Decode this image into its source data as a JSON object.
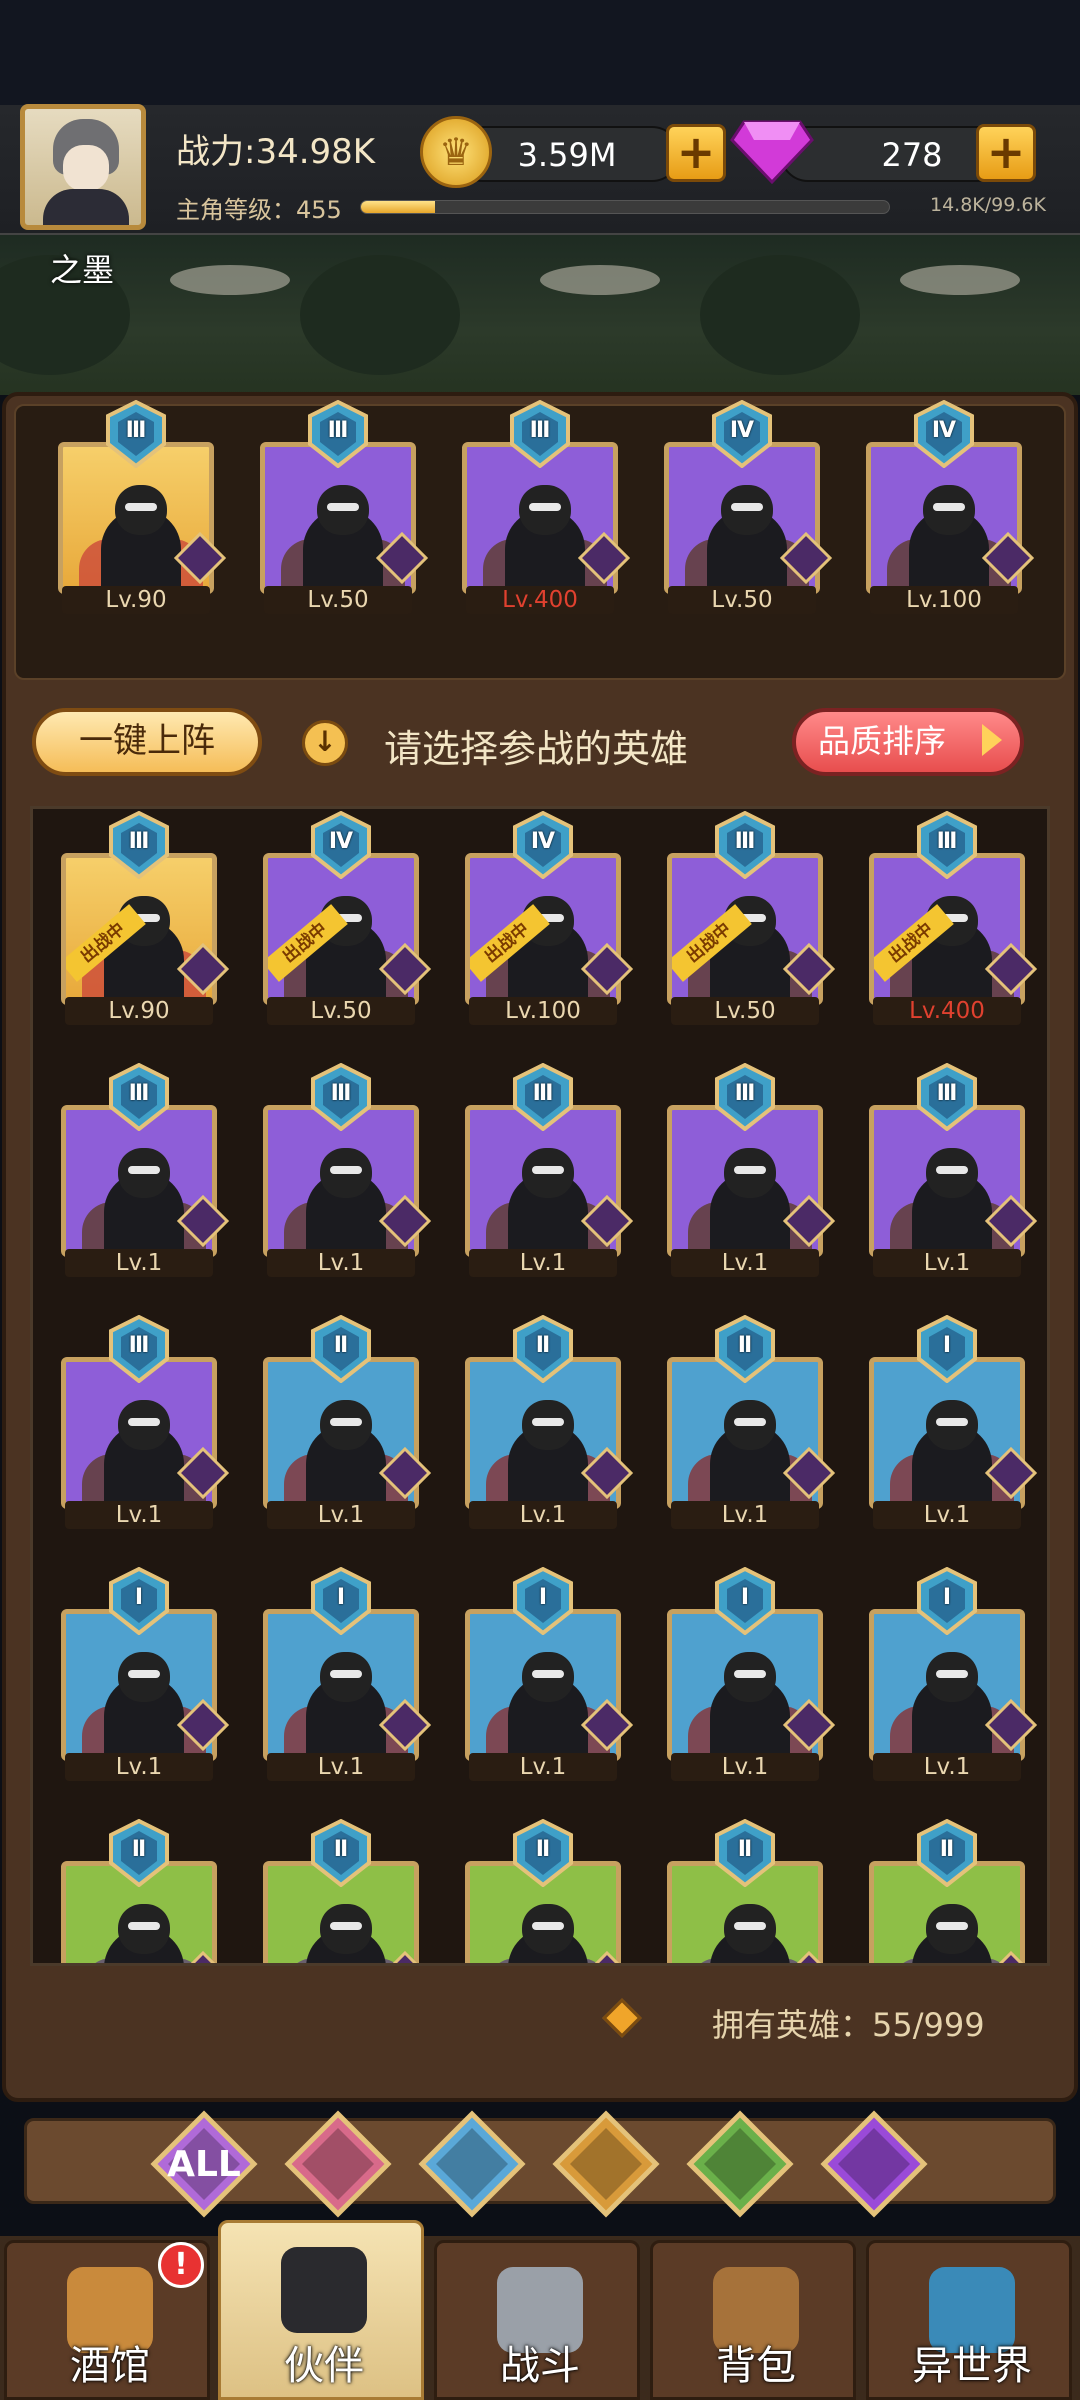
{
  "header": {
    "power": "战力:34.98K",
    "level_label": "主角等级：455",
    "level_progress": 0.14,
    "exp_text": "14.8K/99.6K",
    "player_name": "之墨",
    "coins": "3.59M",
    "gems": "278",
    "coin_icon": "crown-coin-icon",
    "gem_icon": "purple-gem-icon"
  },
  "team": [
    {
      "rank": "Ⅲ",
      "level": "Lv.90",
      "bg": "gold",
      "class_icon": "masked-crown-icon",
      "level_red": false
    },
    {
      "rank": "Ⅲ",
      "level": "Lv.50",
      "bg": "purple",
      "class_icon": "demon-icon",
      "level_red": false
    },
    {
      "rank": "Ⅲ",
      "level": "Lv.400",
      "bg": "purple",
      "class_icon": "masked-crown-icon",
      "level_red": true
    },
    {
      "rank": "Ⅳ",
      "level": "Lv.50",
      "bg": "purple",
      "class_icon": "elf-icon",
      "level_red": false
    },
    {
      "rank": "Ⅳ",
      "level": "Lv.100",
      "bg": "purple",
      "class_icon": "elf-icon",
      "level_red": false
    }
  ],
  "controls": {
    "auto_deploy": "一键上阵",
    "hint": "请选择参战的英雄",
    "sort": "品质排序"
  },
  "deployed_ribbon": "出战中",
  "roster": [
    {
      "rank": "Ⅲ",
      "level": "Lv.90",
      "bg": "gold",
      "deployed": true,
      "level_red": false
    },
    {
      "rank": "Ⅳ",
      "level": "Lv.50",
      "bg": "purple",
      "deployed": true,
      "level_red": false
    },
    {
      "rank": "Ⅳ",
      "level": "Lv.100",
      "bg": "purple",
      "deployed": true,
      "level_red": false
    },
    {
      "rank": "Ⅲ",
      "level": "Lv.50",
      "bg": "purple",
      "deployed": true,
      "level_red": false
    },
    {
      "rank": "Ⅲ",
      "level": "Lv.400",
      "bg": "purple",
      "deployed": true,
      "level_red": true
    },
    {
      "rank": "Ⅲ",
      "level": "Lv.1",
      "bg": "purple",
      "deployed": false,
      "level_red": false
    },
    {
      "rank": "Ⅲ",
      "level": "Lv.1",
      "bg": "purple",
      "deployed": false,
      "level_red": false
    },
    {
      "rank": "Ⅲ",
      "level": "Lv.1",
      "bg": "purple",
      "deployed": false,
      "level_red": false
    },
    {
      "rank": "Ⅲ",
      "level": "Lv.1",
      "bg": "purple",
      "deployed": false,
      "level_red": false
    },
    {
      "rank": "Ⅲ",
      "level": "Lv.1",
      "bg": "purple",
      "deployed": false,
      "level_red": false
    },
    {
      "rank": "Ⅲ",
      "level": "Lv.1",
      "bg": "purple",
      "deployed": false,
      "level_red": false
    },
    {
      "rank": "Ⅱ",
      "level": "Lv.1",
      "bg": "blue",
      "deployed": false,
      "level_red": false
    },
    {
      "rank": "Ⅱ",
      "level": "Lv.1",
      "bg": "blue",
      "deployed": false,
      "level_red": false
    },
    {
      "rank": "Ⅱ",
      "level": "Lv.1",
      "bg": "blue",
      "deployed": false,
      "level_red": false
    },
    {
      "rank": "Ⅰ",
      "level": "Lv.1",
      "bg": "blue",
      "deployed": false,
      "level_red": false
    },
    {
      "rank": "Ⅰ",
      "level": "Lv.1",
      "bg": "blue",
      "deployed": false,
      "level_red": false
    },
    {
      "rank": "Ⅰ",
      "level": "Lv.1",
      "bg": "blue",
      "deployed": false,
      "level_red": false
    },
    {
      "rank": "Ⅰ",
      "level": "Lv.1",
      "bg": "blue",
      "deployed": false,
      "level_red": false
    },
    {
      "rank": "Ⅰ",
      "level": "Lv.1",
      "bg": "blue",
      "deployed": false,
      "level_red": false
    },
    {
      "rank": "Ⅰ",
      "level": "Lv.1",
      "bg": "blue",
      "deployed": false,
      "level_red": false
    },
    {
      "rank": "Ⅱ",
      "level": "",
      "bg": "green",
      "deployed": false,
      "level_red": false
    },
    {
      "rank": "Ⅱ",
      "level": "",
      "bg": "green",
      "deployed": false,
      "level_red": false
    },
    {
      "rank": "Ⅱ",
      "level": "",
      "bg": "green",
      "deployed": false,
      "level_red": false
    },
    {
      "rank": "Ⅱ",
      "level": "",
      "bg": "green",
      "deployed": false,
      "level_red": false
    },
    {
      "rank": "Ⅱ",
      "level": "",
      "bg": "green",
      "deployed": false,
      "level_red": false
    }
  ],
  "owned_heroes": "拥有英雄：55/999",
  "filters": [
    {
      "label": "ALL",
      "icon": "all-filter-icon",
      "color": "#b06ad8"
    },
    {
      "label": "",
      "icon": "masked-crown-icon",
      "color": "#d86a8a"
    },
    {
      "label": "",
      "icon": "fishman-icon",
      "color": "#5aa8d8"
    },
    {
      "label": "",
      "icon": "lion-icon",
      "color": "#d89a3a"
    },
    {
      "label": "",
      "icon": "elf-icon",
      "color": "#6ab04a"
    },
    {
      "label": "",
      "icon": "demon-icon",
      "color": "#9a4ad8"
    }
  ],
  "nav": [
    {
      "label": "酒馆",
      "icon": "beer-mug-icon",
      "active": false,
      "badge": "!"
    },
    {
      "label": "伙伴",
      "icon": "partner-icon",
      "active": true
    },
    {
      "label": "战斗",
      "icon": "crossed-swords-icon",
      "active": false
    },
    {
      "label": "背包",
      "icon": "treasure-chest-icon",
      "active": false
    },
    {
      "label": "异世界",
      "icon": "portal-icon",
      "active": false
    }
  ]
}
